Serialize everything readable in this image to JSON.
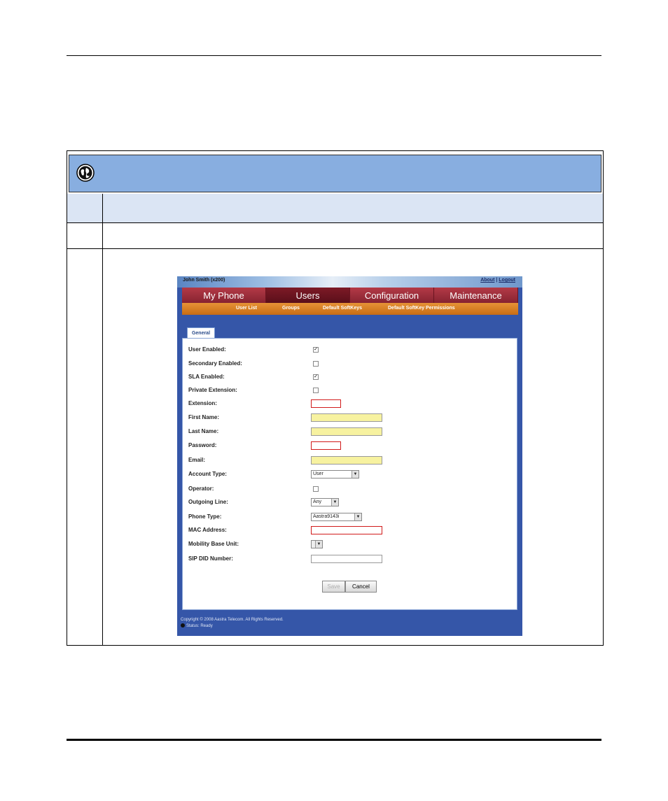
{
  "app": {
    "user_name": "John Smith (x200)",
    "about_link": "About",
    "link_separator": "|",
    "logout_link": "Logout",
    "tabs": [
      "My Phone",
      "Users",
      "Configuration",
      "Maintenance"
    ],
    "active_tab": "Users",
    "subnav": [
      "User List",
      "Groups",
      "Default SoftKeys",
      "Default SoftKey Permissions"
    ],
    "panel_tab": "General",
    "fields": {
      "user_enabled": {
        "label": "User Enabled:",
        "checked": "✓"
      },
      "secondary_enabled": {
        "label": "Secondary Enabled:",
        "checked": ""
      },
      "sla_enabled": {
        "label": "SLA Enabled:",
        "checked": "✓"
      },
      "private_extension": {
        "label": "Private Extension:",
        "checked": ""
      },
      "extension": {
        "label": "Extension:",
        "value": ""
      },
      "first_name": {
        "label": "First Name:",
        "value": ""
      },
      "last_name": {
        "label": "Last Name:",
        "value": ""
      },
      "password": {
        "label": "Password:",
        "value": ""
      },
      "email": {
        "label": "Email:",
        "value": ""
      },
      "account_type": {
        "label": "Account Type:",
        "value": "User"
      },
      "operator": {
        "label": "Operator:",
        "checked": ""
      },
      "outgoing_line": {
        "label": "Outgoing Line:",
        "value": "Any"
      },
      "phone_type": {
        "label": "Phone Type:",
        "value": "Aastra9143i"
      },
      "mac_address": {
        "label": "MAC Address:",
        "value": ""
      },
      "mobility_base_unit": {
        "label": "Mobility Base Unit:",
        "value": ""
      },
      "sip_did_number": {
        "label": "SIP DID Number:",
        "value": ""
      }
    },
    "save_label": "Save",
    "cancel_label": "Cancel",
    "copyright": "Copyright © 2008 Aastra Telecom. All Rights Reserved.",
    "status": "Status: Ready"
  }
}
